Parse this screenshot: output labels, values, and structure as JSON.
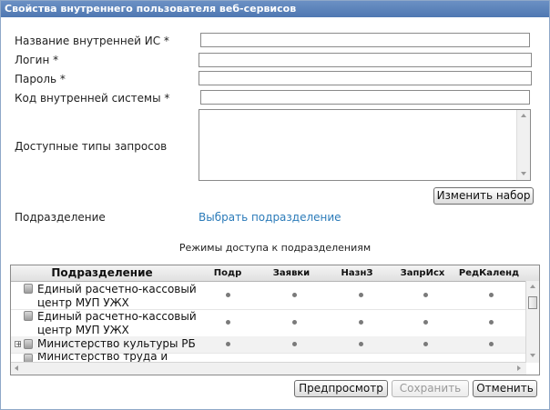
{
  "window": {
    "title": "Свойства внутреннего пользователя веб-сервисов"
  },
  "form": {
    "is_name_label": "Название внутренней ИС *",
    "login_label": "Логин *",
    "password_label": "Пароль *",
    "system_code_label": "Код внутренней системы *",
    "request_types_label": "Доступные типы запросов",
    "change_set_button": "Изменить набор",
    "subdivision_label": "Подразделение",
    "select_subdivision_link": "Выбрать подразделение",
    "is_name_value": "",
    "login_value": "",
    "password_value": "",
    "system_code_value": ""
  },
  "access": {
    "title": "Режимы доступа к подразделениям",
    "columns": [
      "Подразделение",
      "Подр",
      "Заявки",
      "НазнЗ",
      "ЗапрИсх",
      "РедКаленд"
    ],
    "rows": [
      {
        "name": "Единый расчетно-кассовый центр МУП УЖХ",
        "expandable": false,
        "marks": [
          true,
          true,
          true,
          true,
          true
        ]
      },
      {
        "name": "Единый расчетно-кассовый центр МУП УЖХ",
        "expandable": false,
        "marks": [
          true,
          true,
          true,
          true,
          true
        ]
      },
      {
        "name": "Министерство культуры РБ",
        "expandable": true,
        "marks": [
          true,
          true,
          true,
          true,
          true
        ]
      },
      {
        "name": "Министерство труда и",
        "expandable": false,
        "marks": [
          false,
          false,
          false,
          false,
          false
        ]
      }
    ]
  },
  "footer": {
    "preview_button": "Предпросмотр",
    "save_button": "Сохранить",
    "cancel_button": "Отменить",
    "save_disabled": true
  },
  "colors": {
    "titlebar": "#5a81b8",
    "link": "#2b7bb9",
    "disabled_text": "#9a9a9a"
  },
  "icons": [
    "database-icon",
    "plus-expander-icon",
    "scroll-up-icon",
    "scroll-down-icon",
    "scroll-left-icon",
    "scroll-right-icon"
  ]
}
